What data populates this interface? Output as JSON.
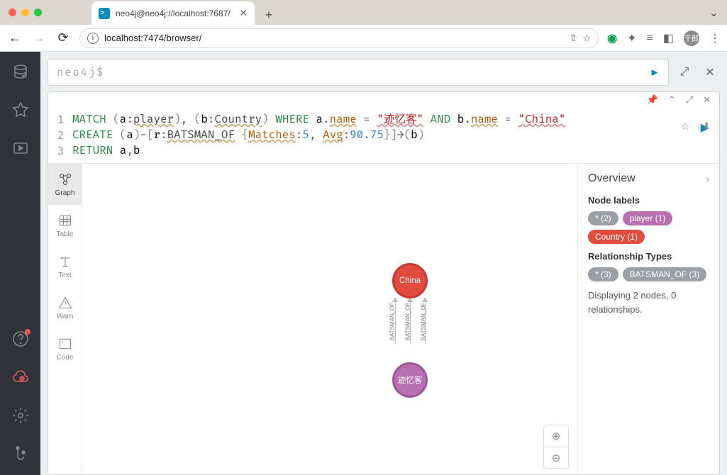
{
  "browser": {
    "tab_title": "neo4j@neo4j://localhost:7687/",
    "url": "localhost:7474/browser/",
    "avatar_text": "千郎"
  },
  "prompt": {
    "placeholder": "neo4j$"
  },
  "editor": {
    "lines": {
      "l1": "1",
      "l2": "2",
      "l3": "3"
    },
    "tokens": {
      "match": "MATCH",
      "where": "WHERE",
      "and": "AND",
      "create": "CREATE",
      "return": "RETURN",
      "a": "a",
      "b": "b",
      "r": "r",
      "player": "player",
      "country": "Country",
      "name": "name",
      "batsman": "BATSMAN_OF",
      "matches": "Matches",
      "avg": "Avg",
      "eq": "=",
      "str1": "\"迹忆客\"",
      "str2": "\"China\"",
      "num1": "5",
      "num2": "90.75",
      "comma": ",",
      "dot": ".",
      "colon": ":",
      "arrow": "→"
    }
  },
  "view_tabs": {
    "graph": "Graph",
    "table": "Table",
    "text": "Text",
    "warn": "Warn",
    "code": "Code"
  },
  "graph": {
    "node_china": "China",
    "node_player": "迹忆客",
    "edge_label": "BATSMAN_OF"
  },
  "overview": {
    "title": "Overview",
    "node_labels": "Node labels",
    "rel_types": "Relationship Types",
    "chip_all_nodes": "* (2)",
    "chip_player": "player (1)",
    "chip_country": "Country (1)",
    "chip_all_rels": "* (3)",
    "chip_batsman": "BATSMAN_OF (3)",
    "message": "Displaying 2 nodes, 0 relationships."
  }
}
